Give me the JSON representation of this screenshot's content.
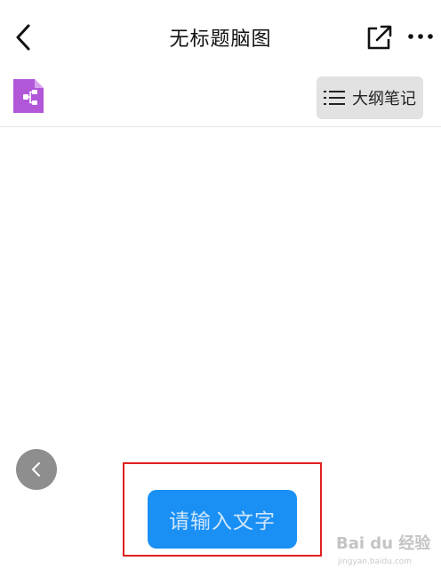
{
  "header": {
    "title": "无标题脑图"
  },
  "toolbar": {
    "outline_label": "大纲笔记"
  },
  "editor": {
    "input_label": "请输入文字"
  },
  "watermark": {
    "brand": "Bai du 经验",
    "url": "jingyan.baidu.com"
  },
  "colors": {
    "accent": "#1a90f5",
    "file_icon": "#b157d8",
    "highlight": "#e02020"
  },
  "icons": {
    "back": "chevron-left-icon",
    "share": "share-icon",
    "more": "more-icon",
    "file": "mindmap-file-icon",
    "outline": "list-icon",
    "collapse": "chevron-left-icon"
  }
}
